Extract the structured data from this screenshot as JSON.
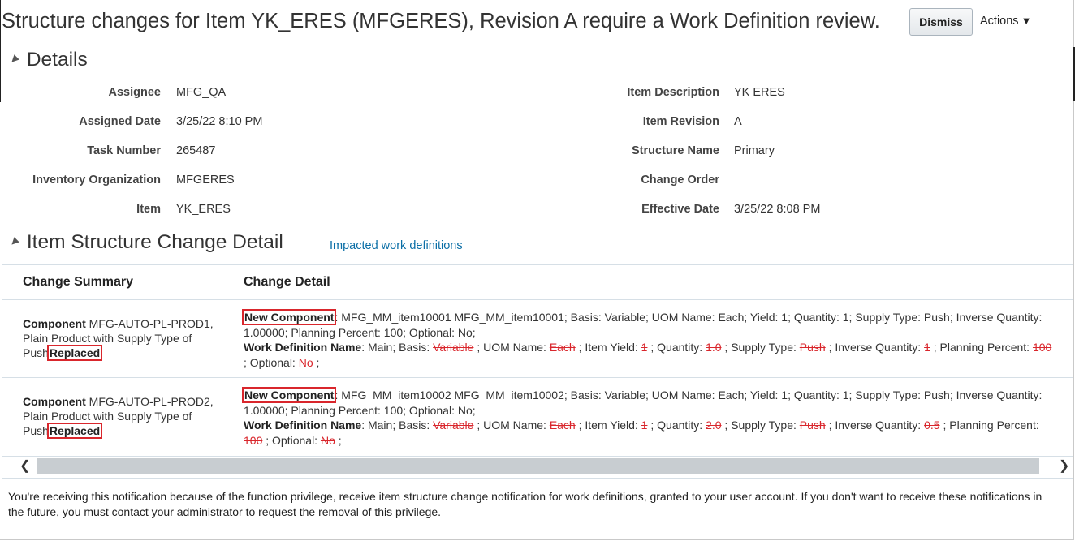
{
  "header": {
    "title": "Structure changes for Item YK_ERES (MFGERES), Revision A require a Work Definition review.",
    "dismiss_label": "Dismiss",
    "actions_label": "Actions",
    "actions_caret": "▼"
  },
  "details": {
    "section_icon": "▲",
    "section_title": "Details",
    "left_fields": [
      {
        "label": "Assignee",
        "value": "MFG_QA"
      },
      {
        "label": "Assigned Date",
        "value": "3/25/22 8:10 PM"
      },
      {
        "label": "Task Number",
        "value": "265487"
      },
      {
        "label": "Inventory Organization",
        "value": "MFGERES"
      },
      {
        "label": "Item",
        "value": "YK_ERES"
      }
    ],
    "right_fields": [
      {
        "label": "Item Description",
        "value": "YK ERES"
      },
      {
        "label": "Item Revision",
        "value": "A"
      },
      {
        "label": "Structure Name",
        "value": "Primary"
      },
      {
        "label": "Change Order",
        "value": ""
      },
      {
        "label": "Effective Date",
        "value": "3/25/22 8:08 PM"
      }
    ]
  },
  "change_detail": {
    "section_icon": "▲",
    "section_title": "Item Structure Change Detail",
    "impacted_link": "Impacted work definitions",
    "columns": [
      "Change Summary",
      "Change Detail"
    ],
    "rows": [
      {
        "summary_bold": "Component",
        "summary_text": " MFG-AUTO-PL-PROD1, Plain Product with Supply Type of Push",
        "summary_status": "Replaced",
        "new_label": "New Component",
        "new_text": ": MFG_MM_item10001 MFG_MM_item10001; Basis: Variable; UOM Name: Each; Yield: 1; Quantity: 1; Supply Type: Push; Inverse Quantity: 1.00000; Planning Percent: 100; Optional: No;",
        "wd_label": "Work Definition Name",
        "wd_parts": [
          {
            "t": ": Main; Basis: "
          },
          {
            "s": "Variable"
          },
          {
            "t": " ; UOM Name: "
          },
          {
            "s": "Each"
          },
          {
            "t": " ; Item Yield: "
          },
          {
            "s": "1"
          },
          {
            "t": " ; Quantity: "
          },
          {
            "s": "1.0"
          },
          {
            "t": " ; Supply Type: "
          },
          {
            "s": "Push"
          },
          {
            "t": " ; Inverse Quantity: "
          },
          {
            "s": "1"
          },
          {
            "t": " ; Planning Percent: "
          },
          {
            "s": "100"
          },
          {
            "t": " ; Optional: "
          },
          {
            "s": "No"
          },
          {
            "t": " ;"
          }
        ]
      },
      {
        "summary_bold": "Component",
        "summary_text": " MFG-AUTO-PL-PROD2, Plain Product with Supply Type of Push",
        "summary_status": "Replaced",
        "new_label": "New Component",
        "new_text": ": MFG_MM_item10002 MFG_MM_item10002; Basis: Variable; UOM Name: Each; Yield: 1; Quantity: 1; Supply Type: Push; Inverse Quantity: 1.00000; Planning Percent: 100; Optional: No;",
        "wd_label": "Work Definition Name",
        "wd_parts": [
          {
            "t": ": Main; Basis: "
          },
          {
            "s": "Variable"
          },
          {
            "t": " ; UOM Name: "
          },
          {
            "s": "Each"
          },
          {
            "t": " ; Item Yield: "
          },
          {
            "s": "1"
          },
          {
            "t": " ; Quantity: "
          },
          {
            "s": "2.0"
          },
          {
            "t": " ; Supply Type: "
          },
          {
            "s": "Push"
          },
          {
            "t": " ; Inverse Quantity: "
          },
          {
            "s": "0.5"
          },
          {
            "t": " ; Planning Percent: "
          },
          {
            "s": "100"
          },
          {
            "t": " ; Optional: "
          },
          {
            "s": "No"
          },
          {
            "t": " ;"
          }
        ]
      }
    ]
  },
  "scroll": {
    "left_arrow": "❮",
    "right_arrow": "❯"
  },
  "footer": {
    "note": "You're receiving this notification because of the function privilege, receive item structure change notification for work definitions, granted to your user account. If you don't want to receive these notifications in the future, you must contact your administrator to request the removal of this privilege."
  }
}
